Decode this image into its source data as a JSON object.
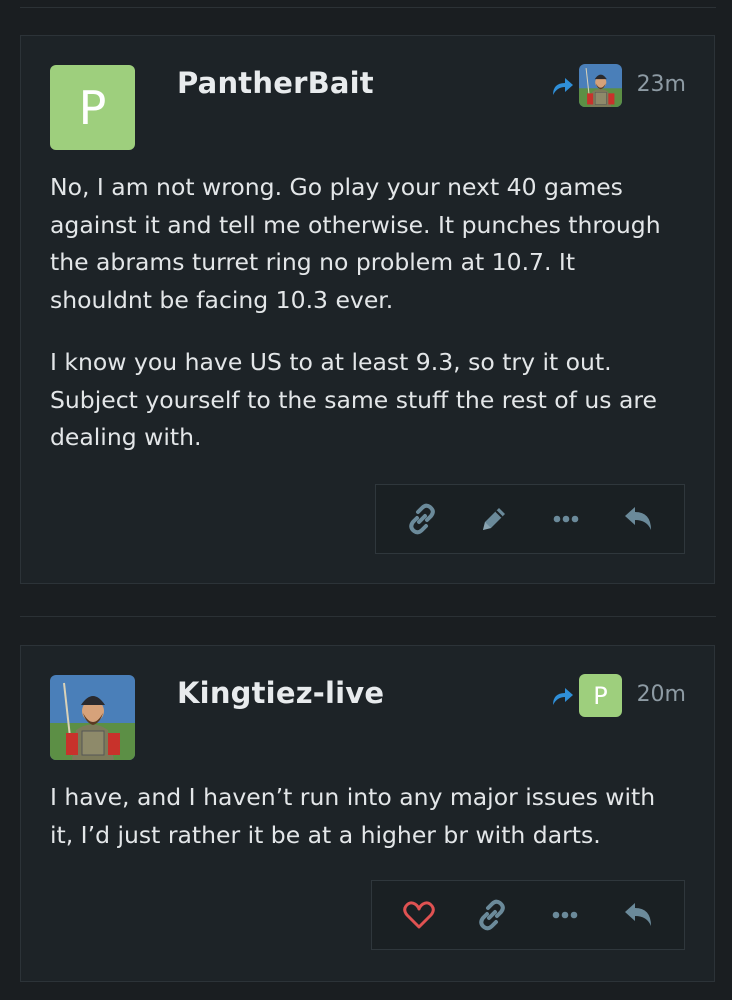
{
  "posts": [
    {
      "username": "PantherBait",
      "avatar_letter": "P",
      "avatar_color": "#9ecf7d",
      "reply_to_avatar": "knight-avatar",
      "time": "23m",
      "paragraphs": [
        "No, I am not wrong. Go play your next 40 games against it and tell me otherwise. It punches through the abrams turret ring no problem at 10.7. It shouldnt be facing 10.3 ever.",
        "I know you have US to at least 9.3, so try it out. Subject yourself to the same stuff the rest of us are dealing with."
      ],
      "actions": [
        "link-icon",
        "pencil-icon",
        "more-icon",
        "reply-icon"
      ]
    },
    {
      "username": "Kingtiez-live",
      "avatar": "knight-avatar",
      "reply_to_letter": "P",
      "time": "20m",
      "paragraphs": [
        "I have, and I haven’t run into any major issues with it, I’d just rather it be at a higher br with darts."
      ],
      "actions": [
        "heart-icon",
        "link-icon",
        "more-icon",
        "reply-icon"
      ]
    }
  ],
  "colors": {
    "background": "#1a1e21",
    "accent": "#2f8fd8",
    "icon": "#6b8a9a",
    "heart": "#e05252",
    "avatar_green": "#9ecf7d"
  }
}
